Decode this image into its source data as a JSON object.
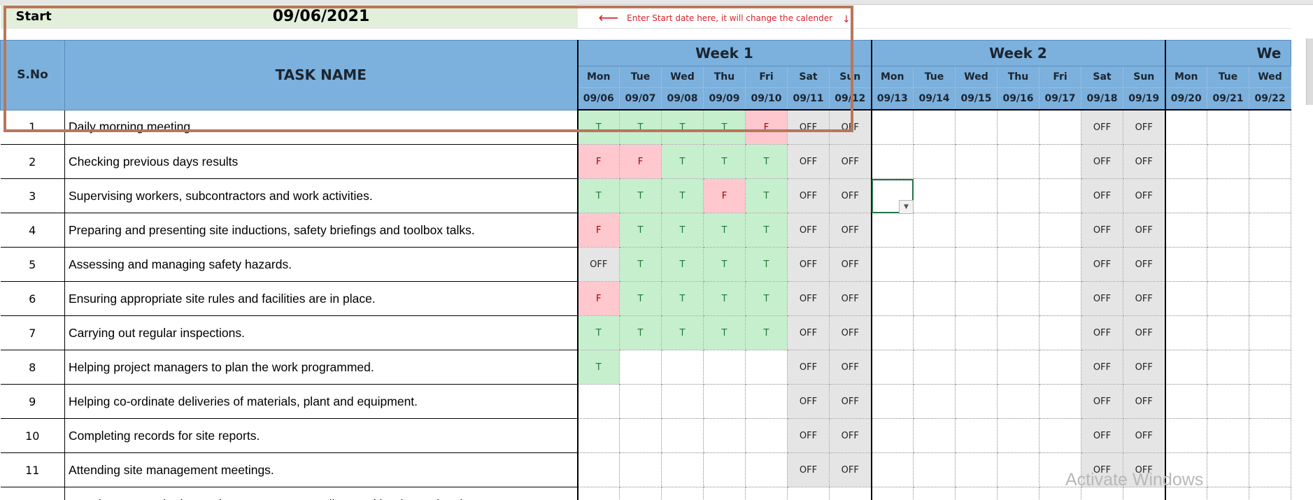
{
  "start": {
    "label": "Start",
    "date": "09/06/2021"
  },
  "note": {
    "arrow_left": "⟵",
    "text": "Enter Start date here, it will change the calender",
    "arrow_down": "↓"
  },
  "headers": {
    "sno": "S.No",
    "task": "TASK NAME"
  },
  "weeks": [
    {
      "label": "Week 1",
      "days": [
        "Mon",
        "Tue",
        "Wed",
        "Thu",
        "Fri",
        "Sat",
        "Sun"
      ],
      "dates": [
        "09/06",
        "09/07",
        "09/08",
        "09/09",
        "09/10",
        "09/11",
        "09/12"
      ]
    },
    {
      "label": "Week 2",
      "days": [
        "Mon",
        "Tue",
        "Wed",
        "Thu",
        "Fri",
        "Sat",
        "Sun"
      ],
      "dates": [
        "09/13",
        "09/14",
        "09/15",
        "09/16",
        "09/17",
        "09/18",
        "09/19"
      ]
    },
    {
      "label": "We",
      "days": [
        "Mon",
        "Tue",
        "Wed"
      ],
      "dates": [
        "09/20",
        "09/21",
        "09/22"
      ]
    }
  ],
  "rows": [
    {
      "sno": "1",
      "task": "Daily morning meeting",
      "w1": [
        "T",
        "T",
        "T",
        "T",
        "F",
        "OFF",
        "OFF"
      ]
    },
    {
      "sno": "2",
      "task": "Checking previous days results",
      "w1": [
        "F",
        "F",
        "T",
        "T",
        "T",
        "OFF",
        "OFF"
      ]
    },
    {
      "sno": "3",
      "task": "Supervising workers, subcontractors and work activities.",
      "w1": [
        "T",
        "T",
        "T",
        "F",
        "T",
        "OFF",
        "OFF"
      ]
    },
    {
      "sno": "4",
      "task": "Preparing and presenting site inductions, safety briefings and toolbox talks.",
      "w1": [
        "F",
        "T",
        "T",
        "T",
        "T",
        "OFF",
        "OFF"
      ]
    },
    {
      "sno": "5",
      "task": "Assessing and managing safety hazards.",
      "w1": [
        "OFF",
        "T",
        "T",
        "T",
        "T",
        "OFF",
        "OFF"
      ]
    },
    {
      "sno": "6",
      "task": "Ensuring appropriate site rules and facilities are in place.",
      "w1": [
        "F",
        "T",
        "T",
        "T",
        "T",
        "OFF",
        "OFF"
      ]
    },
    {
      "sno": "7",
      "task": "Carrying out regular inspections.",
      "w1": [
        "T",
        "T",
        "T",
        "T",
        "T",
        "OFF",
        "OFF"
      ]
    },
    {
      "sno": "8",
      "task": "Helping project managers to plan the work programmed.",
      "w1": [
        "T",
        "",
        "",
        "",
        "",
        "OFF",
        "OFF"
      ]
    },
    {
      "sno": "9",
      "task": "Helping co-ordinate deliveries of materials, plant and equipment.",
      "w1": [
        "",
        "",
        "",
        "",
        "",
        "OFF",
        "OFF"
      ]
    },
    {
      "sno": "10",
      "task": "Completing records for site reports.",
      "w1": [
        "",
        "",
        "",
        "",
        "",
        "OFF",
        "OFF"
      ]
    },
    {
      "sno": "11",
      "task": "Attending site management meetings.",
      "w1": [
        "",
        "",
        "",
        "",
        "",
        "OFF",
        "OFF"
      ]
    },
    {
      "sno": "",
      "task": "Carrying out regular inspections to ensure compliance with relevant legal",
      "w1": [
        "",
        "",
        "",
        "",
        "",
        "",
        ""
      ]
    }
  ],
  "off_label": "OFF",
  "watermark": "Activate Windows",
  "colors": {
    "header": "#7cb0dd",
    "start_bg": "#e2efda",
    "true": "#c6efce",
    "false": "#ffc7ce",
    "off": "#e5e5e5",
    "note": "#d9232e",
    "box": "#b9765a"
  }
}
